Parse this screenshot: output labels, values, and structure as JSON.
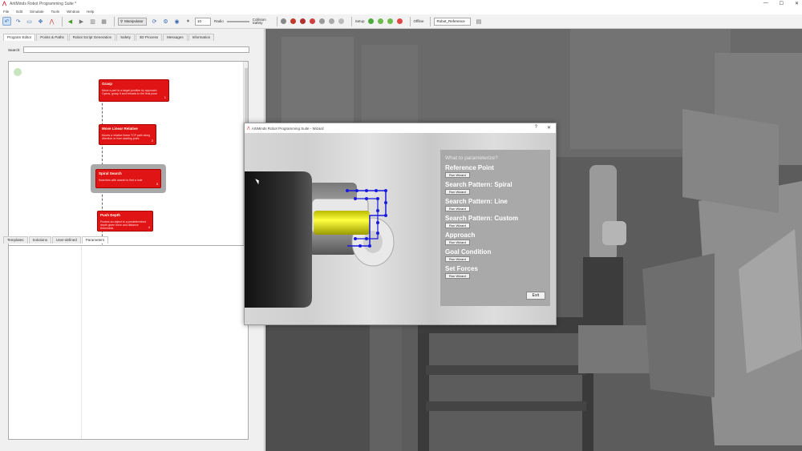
{
  "window": {
    "title": "ArtiMinds Robot Programming Suite *",
    "controls": [
      "—",
      "☐",
      "✕"
    ]
  },
  "menu": [
    "File",
    "Edit",
    "Simulate",
    "Tools",
    "Window",
    "Help"
  ],
  "toolbar": {
    "manipulator_label": "Manipulator",
    "step_value": "10",
    "speed_label": "Radio",
    "collision_label": "Collision Safety",
    "setup_label": "Setup",
    "offline_label": "Offline",
    "reference_value": "Robot_Reference"
  },
  "left": {
    "tabs": [
      "Program Editor",
      "Points & Paths",
      "Robot Script Generation",
      "Safety",
      "3D Process",
      "Messages",
      "Information"
    ],
    "search_label": "Search:",
    "search_value": "",
    "nodes": [
      {
        "title": "Grasp",
        "desc": "Move a part to a target position by approach. Opens, grasp it and retracts to the final pose.",
        "num": "1"
      },
      {
        "title": "Move Linear Relative",
        "desc": "Moves a relative linear TCP path along direction or from starting point.",
        "num": "2"
      },
      {
        "title": "Spiral Search",
        "desc": "Searches with search to find a hole",
        "num": "3"
      },
      {
        "title": "Push Depth",
        "desc": "Pushes an object to a predetermined depth given force and distance thresholds.",
        "num": "4"
      }
    ],
    "lower_tabs": [
      "Templates",
      "Solutions",
      "User-defined",
      "Parameters"
    ]
  },
  "wizard": {
    "title": "ArtiMinds Robot Programming Suite - Wizard",
    "controls": [
      "?",
      "✕"
    ],
    "header": "What to parameterize?",
    "items": [
      {
        "label": "Reference Point",
        "button": "Run Wizard"
      },
      {
        "label": "Search Pattern: Spiral",
        "button": "Run Wizard"
      },
      {
        "label": "Search Pattern: Line",
        "button": "Run Wizard"
      },
      {
        "label": "Search Pattern: Custom",
        "button": "Run Wizard"
      },
      {
        "label": "Approach",
        "button": "Run Wizard"
      },
      {
        "label": "Goal Condition",
        "button": "Run Wizard"
      },
      {
        "label": "Set Forces",
        "button": "Run Wizard"
      }
    ],
    "exit_label": "Exit"
  },
  "colors": {
    "node_red": "#e01414",
    "viewport_bg": "#5a5a5a",
    "param_panel": "#a9a9a9",
    "peg_yellow": "#e8e800",
    "path_blue": "#1a1ae0"
  }
}
